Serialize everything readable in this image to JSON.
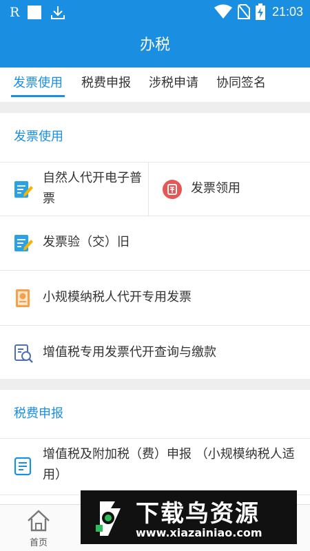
{
  "status_bar": {
    "time": "21:03",
    "carrier_glyph": "R",
    "icons": [
      "square-icon",
      "download-icon",
      "wifi-icon",
      "no-sim-icon",
      "battery-charging-icon"
    ]
  },
  "app_bar": {
    "title": "办税"
  },
  "tabs": [
    {
      "label": "发票使用",
      "active": true
    },
    {
      "label": "税费申报",
      "active": false
    },
    {
      "label": "涉税申请",
      "active": false
    },
    {
      "label": "协同签名",
      "active": false
    }
  ],
  "invoice_section": {
    "title": "发票使用",
    "items": [
      {
        "label_line1": "自然人代开电子普",
        "label_line2": "票",
        "icon": "document-edit-icon"
      },
      {
        "label": "发票领用",
        "icon": "red-seal-icon"
      },
      {
        "label": "发票验（交）旧",
        "icon": "document-edit-icon"
      },
      {
        "label": "小规模纳税人代开专用发票",
        "icon": "certificate-icon"
      },
      {
        "label": "增值税专用发票代开查询与缴款",
        "icon": "search-document-icon"
      }
    ]
  },
  "tax_section": {
    "title": "税费申报",
    "items": [
      {
        "label_line1": "增值税及附加税（费）申报 （小规模纳税人适",
        "label_line2": "用）",
        "icon": "form-icon"
      }
    ]
  },
  "bottom_nav": [
    {
      "label": "首页",
      "icon": "home-icon"
    }
  ],
  "watermark": {
    "title": "下载鸟资源",
    "url": "www.xiazainiao.com"
  },
  "colors": {
    "primary": "#1a8ee1",
    "background": "#eeeeee",
    "text": "#333333"
  }
}
